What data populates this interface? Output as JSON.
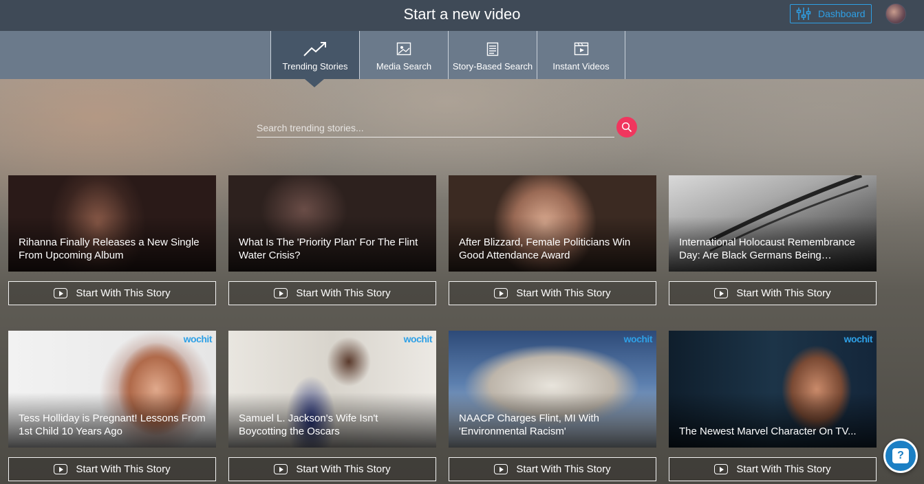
{
  "header": {
    "title": "Start a new video",
    "dashboard_label": "Dashboard",
    "accent": "#2ea0e6"
  },
  "tabs": [
    {
      "label": "Trending Stories",
      "icon": "trending-icon",
      "active": true
    },
    {
      "label": "Media Search",
      "icon": "image-icon",
      "active": false
    },
    {
      "label": "Story-Based Search",
      "icon": "document-icon",
      "active": false
    },
    {
      "label": "Instant Videos",
      "icon": "clapper-icon",
      "active": false
    }
  ],
  "search": {
    "placeholder": "Search trending stories...",
    "button_color": "#f0365e"
  },
  "stories": [
    {
      "title": "Rihanna Finally Releases a New Single From Upcoming Album",
      "button": "Start With This Story",
      "watermark": ""
    },
    {
      "title": "What Is The 'Priority Plan' For The Flint Water Crisis?",
      "button": "Start With This Story",
      "watermark": ""
    },
    {
      "title": "After Blizzard, Female Politicians Win Good Attendance Award",
      "button": "Start With This Story",
      "watermark": ""
    },
    {
      "title": "International Holocaust Remembrance Day: Are Black Germans Being…",
      "button": "Start With This Story",
      "watermark": ""
    },
    {
      "title": "Tess Holliday is Pregnant! Lessons From 1st Child 10 Years Ago",
      "button": "Start With This Story",
      "watermark": "wochit"
    },
    {
      "title": "Samuel L. Jackson's Wife Isn't Boycotting the Oscars",
      "button": "Start With This Story",
      "watermark": "wochit"
    },
    {
      "title": "NAACP Charges Flint, MI With 'Environmental Racism'",
      "button": "Start With This Story",
      "watermark": "wochit"
    },
    {
      "title": "The Newest Marvel Character On TV...",
      "button": "Start With This Story",
      "watermark": "wochit"
    }
  ],
  "help": {
    "icon": "help-icon",
    "glyph": "?"
  }
}
